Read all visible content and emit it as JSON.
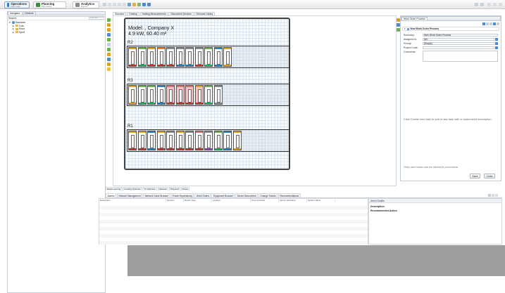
{
  "modules": [
    {
      "title": "Operations",
      "subtitle": "Daily tasks",
      "color": "#2e7cc9"
    },
    {
      "title": "Planning",
      "subtitle": "Plan ahead",
      "color": "#3b8e3b"
    },
    {
      "title": "Analytics",
      "subtitle": "Reports",
      "color": "#8a8a8a"
    }
  ],
  "left_panel": {
    "tabs": [
      "Navigator",
      "Devices"
    ],
    "search_label": "Search:",
    "filter_label": "Type filter",
    "tree": [
      {
        "label": "Standard",
        "level": 0
      },
      {
        "label": "Cole",
        "level": 1
      },
      {
        "label": "Ernst",
        "level": 1
      },
      {
        "label": "Sport",
        "level": 1
      }
    ]
  },
  "editor_tabs": [
    "Standard",
    "Holding",
    "Holding Measurements",
    "Discovered Devices",
    "Genome Library"
  ],
  "floor": {
    "model_line1": "Model: , Company X",
    "model_line2": "4.9 kW, 60.40 m²",
    "rows": [
      {
        "label": "R2",
        "racks": [
          {
            "top": "#e0a020",
            "bottom": "#c0392b",
            "fill": "#ffffff"
          },
          {
            "top": "#6ab04c",
            "bottom": "#27ae60",
            "fill": "#ffffff"
          },
          {
            "top": "#e0a020",
            "bottom": "#c0392b",
            "fill": "#ffffff"
          },
          {
            "top": "#e67e22",
            "bottom": "#c0392b",
            "fill": "#ffffff"
          },
          {
            "top": "#888888",
            "bottom": "#c0392b",
            "fill": "#ffffff"
          },
          {
            "top": "#888888",
            "bottom": "#2980b9",
            "fill": "#ffffff"
          },
          {
            "top": "#888888",
            "bottom": "#2980b9",
            "fill": "#ffffff"
          },
          {
            "top": "#888888",
            "bottom": "#c0392b",
            "fill": "#ffffff"
          },
          {
            "top": "#6ab04c",
            "bottom": "#27ae60",
            "fill": "#ffffff"
          },
          {
            "top": "#2980b9",
            "bottom": "#2980b9",
            "fill": "#ffffff"
          },
          {
            "top": "#e0a020",
            "bottom": "#e0a020",
            "fill": "#ffffff"
          }
        ]
      },
      {
        "label": "R3",
        "racks": [
          {
            "top": "#e0a020",
            "bottom": "#e0a020",
            "fill": "#ffffff"
          },
          {
            "top": "#6ab04c",
            "bottom": "#27ae60",
            "fill": "#ffffff"
          },
          {
            "top": "#6ab04c",
            "bottom": "#27ae60",
            "fill": "#ffffff"
          },
          {
            "top": "#2980b9",
            "bottom": "#2980b9",
            "fill": "#ffffff"
          },
          {
            "top": "#e07070",
            "bottom": "#c0392b",
            "fill": "#f6c6c6"
          },
          {
            "top": "#e07070",
            "bottom": "#c0392b",
            "fill": "#f6c6c6"
          },
          {
            "top": "#e07070",
            "bottom": "#c0392b",
            "fill": "#f6c6c6"
          },
          {
            "top": "#e0a020",
            "bottom": "#c0392b",
            "fill": "#f6c6c6"
          },
          {
            "top": "#6ab04c",
            "bottom": "#27ae60",
            "fill": "#ffffff"
          },
          {
            "top": "#888888",
            "bottom": "#888888",
            "fill": "#ffffff"
          }
        ]
      },
      {
        "label": "R1",
        "racks": [
          {
            "top": "#e0a020",
            "bottom": "#c0392b",
            "fill": "#ffffff"
          },
          {
            "top": "#e0a020",
            "bottom": "#c0392b",
            "fill": "#ffffff"
          },
          {
            "top": "#2980b9",
            "bottom": "#2980b9",
            "fill": "#ffffff"
          },
          {
            "top": "#e0a020",
            "bottom": "#c0392b",
            "fill": "#ffffff"
          },
          {
            "top": "#888888",
            "bottom": "#c0392b",
            "fill": "#ffffff"
          },
          {
            "top": "#e0a020",
            "bottom": "#c0392b",
            "fill": "#ffffff"
          },
          {
            "top": "#888888",
            "bottom": "#c0392b",
            "fill": "#ffffff"
          },
          {
            "top": "#e07070",
            "bottom": "#c0392b",
            "fill": "#ffffff"
          },
          {
            "top": "#888888",
            "bottom": "#8e44ad",
            "fill": "#ffffff"
          },
          {
            "top": "#6ab04c",
            "bottom": "#27ae60",
            "fill": "#ffffff"
          },
          {
            "top": "#2980b9",
            "bottom": "#2980b9",
            "fill": "#ffffff"
          },
          {
            "top": "#e0a020",
            "bottom": "#e0a020",
            "fill": "#ffffff"
          }
        ]
      }
    ]
  },
  "work_order": {
    "panel_title": "Work Order Process",
    "section_title": "New Work Order Process",
    "fields": [
      {
        "label": "Summary:",
        "value": "New Work Order Process",
        "dropdown": false
      },
      {
        "label": "Assigned to:",
        "value": "kim",
        "dropdown": true
      },
      {
        "label": "Priority:",
        "value": "(Empty)",
        "dropdown": true
      },
      {
        "label": "Project Code:",
        "value": "",
        "dropdown": true
      },
      {
        "label": "Comments:",
        "value": "",
        "dropdown": false
      }
    ],
    "hint1": "Click Create new task to add a new task with a customized description.",
    "hint2": "Only user tasks can be added to processes.",
    "save_label": "Save",
    "close_label": "Close"
  },
  "bottom_tabs": [
    "Data Layering",
    "Cooling Optimize",
    "IT Optimize",
    "Network",
    "Physical",
    "Power"
  ],
  "console_tabs": [
    "Alarms",
    "Network Management",
    "Network Cable Browser",
    "Power Dependency",
    "Work Orders",
    "Equipment Browser",
    "Server Discoveries",
    "Change Tickets",
    "Recommendations"
  ],
  "alarm_columns": [
    "Description",
    "Severity",
    "Device Type",
    "Location",
    "Time Occurred",
    "Server Hostname",
    "System Name"
  ],
  "details": {
    "title": "Alarm Details",
    "description_label": "Description",
    "recommended_label": "Recommended Action"
  }
}
